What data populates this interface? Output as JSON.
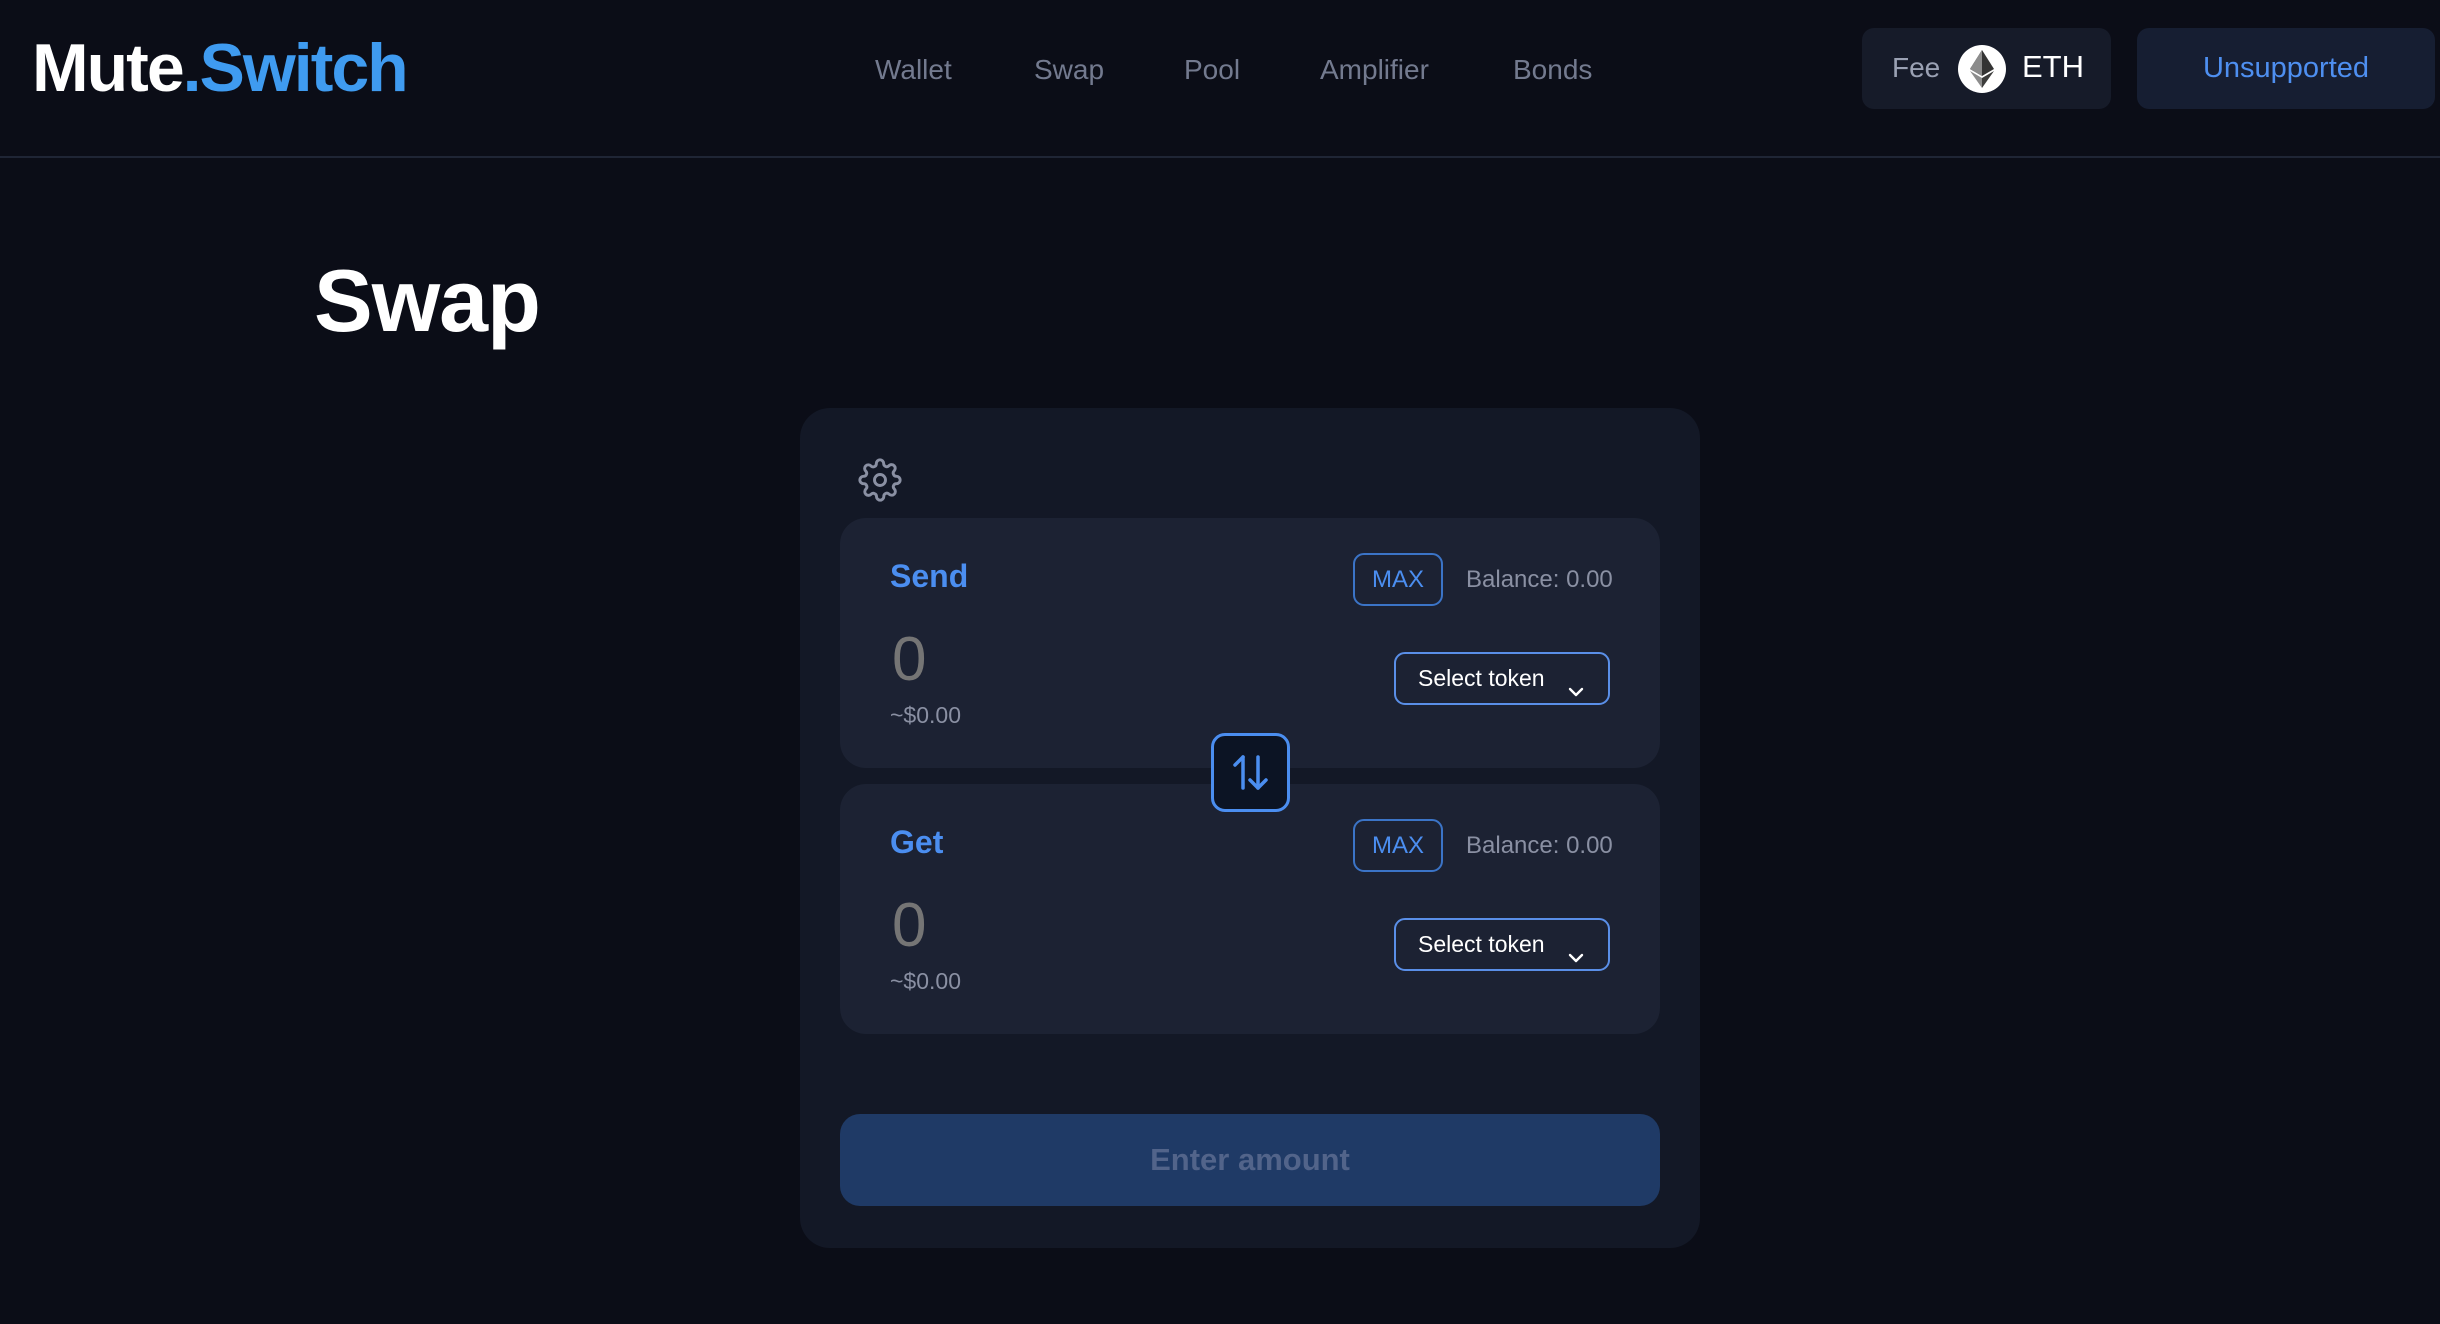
{
  "header": {
    "logo": {
      "part1": "Mute",
      "part2": ".Switch"
    },
    "nav": [
      "Wallet",
      "Swap",
      "Pool",
      "Amplifier",
      "Bonds"
    ],
    "fee": {
      "label": "Fee",
      "token": "ETH",
      "icon": "ethereum-icon"
    },
    "network_button": "Unsupported"
  },
  "page": {
    "title": "Swap"
  },
  "swap_card": {
    "settings_icon": "gear-icon",
    "send": {
      "label": "Send",
      "max_label": "MAX",
      "balance": "Balance: 0.00",
      "amount": "0",
      "fiat": "~$0.00",
      "select_label": "Select token"
    },
    "toggle_icon": "swap-arrows-icon",
    "get": {
      "label": "Get",
      "max_label": "MAX",
      "balance": "Balance: 0.00",
      "amount": "0",
      "fiat": "~$0.00",
      "select_label": "Select token"
    },
    "submit_label": "Enter amount"
  },
  "colors": {
    "background": "#0b0d17",
    "accent": "#4b8ef0",
    "logo_accent": "#3f9bf0",
    "card": "#131826",
    "panel": "#1c2233"
  }
}
